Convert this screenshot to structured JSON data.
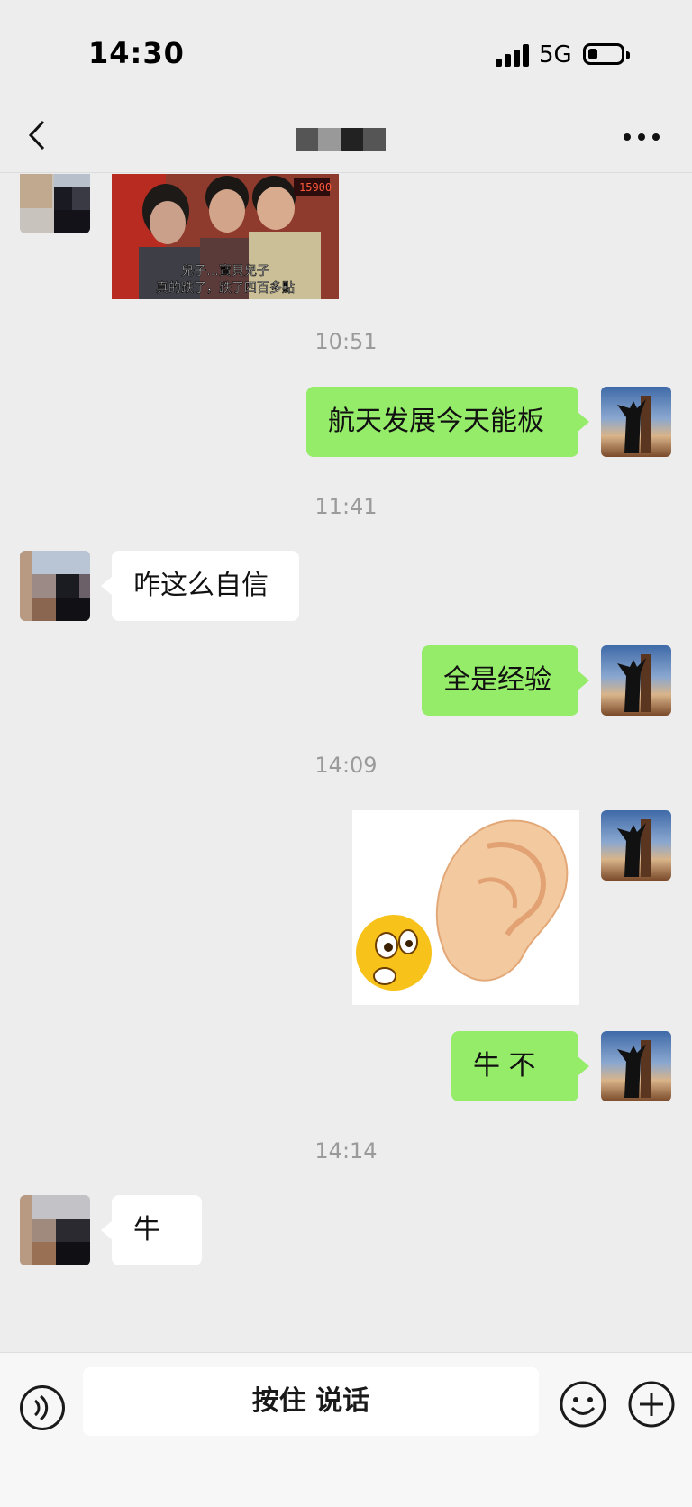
{
  "status_bar": {
    "time": "14:30",
    "network": "5G"
  },
  "nav": {
    "back_icon": "chevron-left-icon",
    "more_icon": "ellipsis-icon"
  },
  "messages": {
    "sticker_1_caption_line1": "兒子…寶貝兒子",
    "sticker_1_caption_line2": "真的跌了，跌了四百多點",
    "sticker_1_ticker": "15900",
    "ts1": "10:51",
    "msg1": "航天发展今天能板",
    "ts2": "11:41",
    "msg2": "咋这么自信",
    "msg3": "全是经验",
    "ts3": "14:09",
    "msg4": "牛    不",
    "ts4": "14:14",
    "msg5": "牛"
  },
  "input_bar": {
    "hold_to_talk": "按住 说话"
  },
  "colors": {
    "bubble_me": "#95ec69",
    "bubble_them": "#ffffff",
    "background": "#ededed"
  }
}
